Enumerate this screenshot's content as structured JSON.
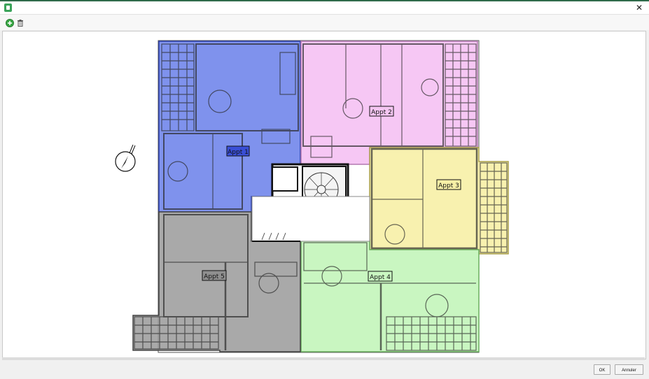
{
  "window": {
    "app_icon": "app-icon",
    "close_glyph": "✕"
  },
  "toolbar": {
    "add_icon": "plus-circle-icon",
    "delete_icon": "trash-icon"
  },
  "plan": {
    "apartments": [
      {
        "label": "Appt 1",
        "color": "#5b73e8"
      },
      {
        "label": "Appt 2",
        "color": "#f5bdf2"
      },
      {
        "label": "Appt 3",
        "color": "#f7f0a6"
      },
      {
        "label": "Appt 4",
        "color": "#bff5b6"
      },
      {
        "label": "Appt 5",
        "color": "#9a9a9a"
      }
    ],
    "compass_icon": "north-arrow-icon"
  },
  "footer": {
    "ok_label": "OK",
    "cancel_label": "Annuler"
  }
}
